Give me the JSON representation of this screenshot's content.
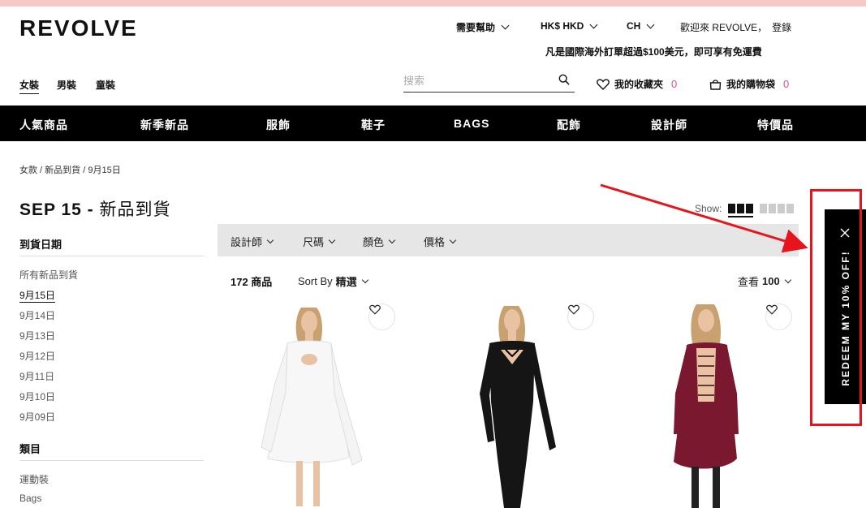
{
  "brand": {
    "logo": "REVOLVE"
  },
  "utility": {
    "help": "需要幫助",
    "currency": "HK$ HKD",
    "language": "CH",
    "welcome": "歡迎來 REVOLVE，",
    "login": "登錄",
    "promo": "凡是國際海外訂單超過$100美元，即可享有免運費"
  },
  "gender_tabs": [
    "女裝",
    "男裝",
    "童裝"
  ],
  "search": {
    "placeholder": "搜索"
  },
  "wishlist": {
    "label": "我的收藏夾",
    "count": "0"
  },
  "cart": {
    "label": "我的購物袋",
    "count": "0"
  },
  "nav": [
    "人氣商品",
    "新季新品",
    "服飾",
    "鞋子",
    "BAGS",
    "配飾",
    "設計師",
    "特價品"
  ],
  "breadcrumb": "女款 / 新品到貨 / 9月15日",
  "page_title": {
    "en": "SEP 15 -",
    "zh": "新品到貨"
  },
  "sidebar": {
    "arrival_heading": "到貨日期",
    "arrival_items": [
      "所有新品到貨",
      "9月15日",
      "9月14日",
      "9月13日",
      "9月12日",
      "9月11日",
      "9月10日",
      "9月09日"
    ],
    "active_index": 1,
    "category_heading": "類目",
    "category_items": [
      "運動裝",
      "Bags"
    ]
  },
  "view": {
    "show_label": "Show:"
  },
  "filters": [
    "設計師",
    "尺碼",
    "顏色",
    "價格"
  ],
  "results": {
    "count": "172 商品",
    "sort_label": "Sort By",
    "sort_value": "精選",
    "view_label": "查看",
    "view_value": "100"
  },
  "products": [
    {
      "color": "#ffffff",
      "name": "white-dress"
    },
    {
      "color": "#111111",
      "name": "black-jumpsuit"
    },
    {
      "color": "#7a1830",
      "name": "burgundy-dress"
    }
  ],
  "redeem": {
    "label": "REDEEM MY 10% OFF!"
  },
  "colors": {
    "accent_pink": "#e04f8a",
    "annotation_red": "#e8141b",
    "nav_bg": "#000000",
    "filter_bg": "#e6e6e6"
  }
}
